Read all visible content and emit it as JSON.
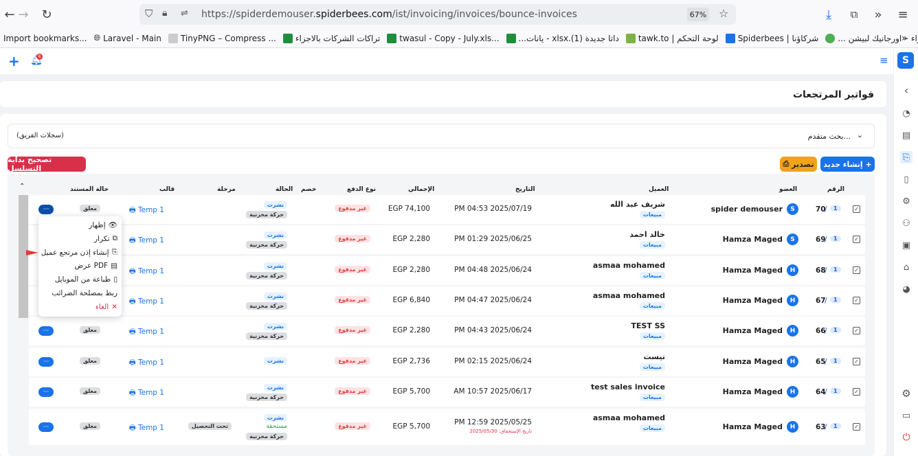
{
  "browser": {
    "url_prefix": "https://spiderdemouser.",
    "url_domain": "spiderbees.com",
    "url_path": "/ist/invoicing/invoices/bounce-invoices",
    "zoom": "67%"
  },
  "bookmarks": [
    {
      "label": "Import bookmarks...",
      "icon": "none"
    },
    {
      "label": "Laravel - Main",
      "icon": "globe-icon"
    },
    {
      "label": "TinyPNG – Compress ...",
      "icon": "panda-icon"
    },
    {
      "label": "تراكات الشركات بالاجزاء",
      "icon": "sheets-icon"
    },
    {
      "label": "twasul - Copy - July.xls...",
      "icon": "sheets-icon"
    },
    {
      "label": "...يانات - xlsx.داتا جديدة (1)",
      "icon": "sheets-icon"
    },
    {
      "label": "tawk.to | لوحة التحكم",
      "icon": "tawk-icon"
    },
    {
      "label": "Spiderbees | شركاؤنا",
      "icon": "spiderbees-icon"
    },
    {
      "label": "... الحمراء – اورجانيك لبيشن",
      "icon": "leaf-icon"
    }
  ],
  "app": {
    "notification_count": "6",
    "page_title": "فواتير المرتجعات"
  },
  "filters": {
    "advanced_search": "بحث متقدم...",
    "team_records": "(سجلات الفريق)"
  },
  "actions": {
    "fix_sequence": "تصحيح بداية التسلسل",
    "export": "تصدير",
    "create_new": "إنشاء جديد"
  },
  "table": {
    "headers": {
      "number": "الرقم",
      "member": "العضو",
      "client": "العميل",
      "date": "التاريخ",
      "total": "الإجمالي",
      "payment_type": "نوع الدفع",
      "discount": "خصم",
      "status": "الحالة",
      "stage": "مرحلة",
      "template": "قالب",
      "doc_status": "حالة المستند"
    },
    "rows": [
      {
        "num": "70",
        "seq": "1",
        "member": "spider demouser",
        "avatar": "S",
        "client": "شريف عبد الله",
        "client_tag": "مبيعات",
        "date": "PM 04:53 2025/07/19",
        "total": "EGP 74,100",
        "payment": "غير مدفوع",
        "status1": "نشرت",
        "status2": "حركة مخزنية",
        "template": "Temp 1",
        "doc": "معلق"
      },
      {
        "num": "69",
        "seq": "1",
        "member": "Hamza Maged",
        "avatar": "S",
        "client": "خالد احمد",
        "client_tag": "مبيعات",
        "date": "PM 01:29 2025/06/25",
        "total": "EGP 2,280",
        "payment": "غير مدفوع",
        "status1": "نشرت",
        "status2": "حركة مخزنية",
        "template": "Temp 1",
        "doc": ""
      },
      {
        "num": "68",
        "seq": "1",
        "member": "Hamza Maged",
        "avatar": "H",
        "client": "asmaa mohamed",
        "client_tag": "مبيعات",
        "date": "PM 04:48 2025/06/24",
        "total": "EGP 2,280",
        "payment": "غير مدفوع",
        "status1": "نشرت",
        "status2": "حركة مخزنية",
        "template": "Temp 1",
        "doc": ""
      },
      {
        "num": "67",
        "seq": "1",
        "member": "Hamza Maged",
        "avatar": "H",
        "client": "asmaa mohamed",
        "client_tag": "مبيعات",
        "date": "PM 04:47 2025/06/24",
        "total": "EGP 6,840",
        "payment": "غير مدفوع",
        "status1": "نشرت",
        "status2": "حركة مخزنية",
        "template": "Temp 1",
        "doc": ""
      },
      {
        "num": "66",
        "seq": "1",
        "member": "Hamza Maged",
        "avatar": "H",
        "client": "TEST SS",
        "client_tag": "مبيعات",
        "date": "PM 04:43 2025/06/24",
        "total": "EGP 2,280",
        "payment": "غير مدفوع",
        "status1": "نشرت",
        "status2": "حركة مخزنية",
        "template": "Temp 1",
        "doc": "معلق"
      },
      {
        "num": "65",
        "seq": "1",
        "member": "Hamza Maged",
        "avatar": "H",
        "client": "تيست",
        "client_tag": "مبيعات",
        "date": "PM 02:15 2025/06/24",
        "total": "EGP 2,736",
        "payment": "غير مدفوع",
        "status1": "نشرت",
        "status2": "",
        "template": "Temp 1",
        "doc": "معلق"
      },
      {
        "num": "64",
        "seq": "1",
        "member": "Hamza Maged",
        "avatar": "H",
        "client": "test sales invoice",
        "client_tag": "مبيعات",
        "date": "AM 10:57 2025/06/17",
        "total": "EGP 5,700",
        "payment": "غير مدفوع",
        "status1": "نشرت",
        "status2": "حركة مخزنية",
        "template": "Temp 1",
        "doc": "معلق"
      },
      {
        "num": "63",
        "seq": "1",
        "member": "Hamza Maged",
        "avatar": "H",
        "client": "asmaa mohamed",
        "client_tag": "مبيعات",
        "date": "PM 12:59 2025/05/25",
        "due": "تاريخ الإستحقاق: 2025/05/30",
        "total": "EGP 5,700",
        "payment": "غير مدفوع",
        "status1": "نشرت",
        "status_due": "مستحقة",
        "status2": "حركة مخزنية",
        "stage": "تحت التحصيل",
        "template": "Temp 1",
        "doc": "معلق"
      }
    ]
  },
  "context_menu": {
    "items": [
      "إظهار",
      "تكرار",
      "إنشاء إذن مرتجع عميل",
      "عرض PDF",
      "طباعة من الموبايل",
      "ربط بمصلحة الضرائب",
      "الغاء"
    ]
  },
  "colors": {
    "primary": "#1a73e8",
    "danger": "#d9304a",
    "warning": "#f0a31b"
  }
}
